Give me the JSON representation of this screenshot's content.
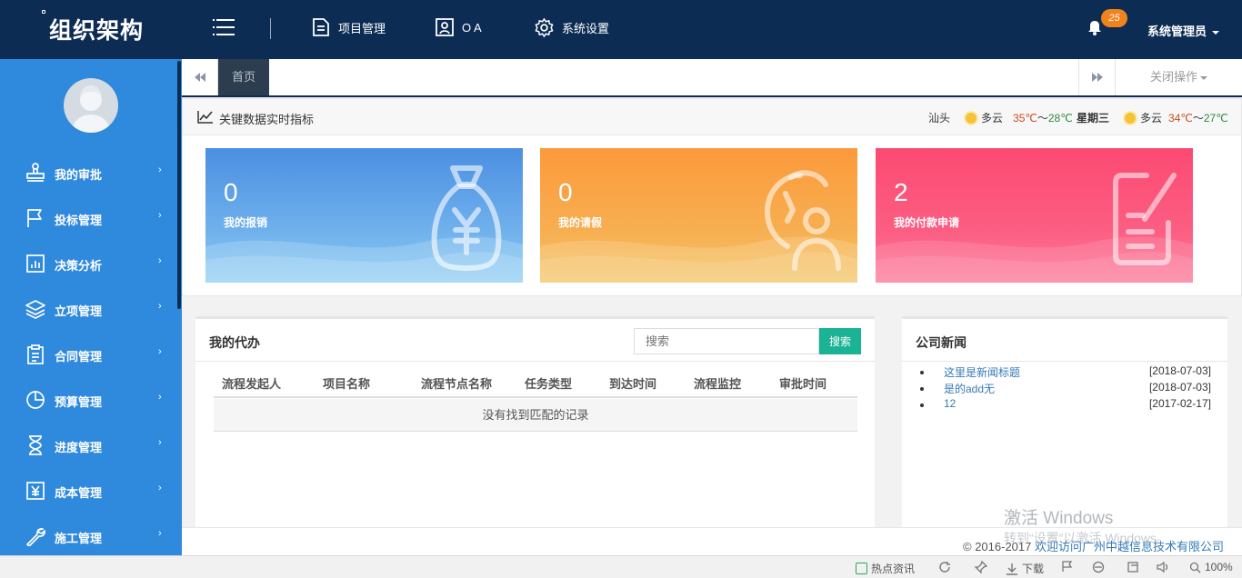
{
  "header": {
    "title": "组织架构",
    "nav": [
      {
        "label": "项目管理",
        "icon": "document-icon"
      },
      {
        "label": "O A",
        "icon": "id-card-icon"
      },
      {
        "label": "系统设置",
        "icon": "gear-icon"
      }
    ],
    "notification_count": "25",
    "user": "系统管理员"
  },
  "sidebar": {
    "items": [
      {
        "label": "我的审批",
        "icon": "stamp-icon"
      },
      {
        "label": "投标管理",
        "icon": "flag-icon"
      },
      {
        "label": "决策分析",
        "icon": "bar-chart-icon"
      },
      {
        "label": "立项管理",
        "icon": "layers-icon"
      },
      {
        "label": "合同管理",
        "icon": "clipboard-icon"
      },
      {
        "label": "预算管理",
        "icon": "pie-chart-icon"
      },
      {
        "label": "进度管理",
        "icon": "hourglass-icon"
      },
      {
        "label": "成本管理",
        "icon": "yen-icon"
      },
      {
        "label": "施工管理",
        "icon": "wrench-icon"
      }
    ],
    "arrow": "›"
  },
  "tabs": {
    "home": "首页",
    "close_ops": "关闭操作"
  },
  "kpi": {
    "title": "关键数据实时指标",
    "weather": {
      "city": "汕头",
      "today": {
        "cond": "多云",
        "high": "35℃",
        "sep": "～",
        "low": "28℃"
      },
      "weekday": "星期三",
      "tomorrow": {
        "cond": "多云",
        "high": "34℃",
        "sep": "～",
        "low": "27℃"
      }
    },
    "cards": [
      {
        "value": "0",
        "label": "我的报销",
        "color_top": "#4a8ee0",
        "color_bottom": "#7ec3ef"
      },
      {
        "value": "0",
        "label": "我的请假",
        "color_top": "#fb9a3c",
        "color_bottom": "#f5c160"
      },
      {
        "value": "2",
        "label": "我的付款申请",
        "color_top": "#fc4c74",
        "color_bottom": "#fd7a9b"
      }
    ]
  },
  "todo": {
    "title": "我的代办",
    "search_placeholder": "搜索",
    "search_button": "搜索",
    "columns": [
      "流程发起人",
      "项目名称",
      "流程节点名称",
      "任务类型",
      "到达时间",
      "流程监控",
      "审批时间"
    ],
    "empty_text": "没有找到匹配的记录"
  },
  "news": {
    "title": "公司新闻",
    "items": [
      {
        "title": "这里是新闻标题",
        "date": "[2018-07-03]"
      },
      {
        "title": "是的add无",
        "date": "[2018-07-03]"
      },
      {
        "title": "12",
        "date": "[2017-02-17]"
      }
    ]
  },
  "footer": {
    "copyright": "© 2016-2017",
    "link": "欢迎访问广州中越信息技术有限公司"
  },
  "watermark": {
    "line1": "激活 Windows",
    "line2": "转到“设置”以激活 Windows。"
  },
  "statusbar": {
    "hot_news": "热点资讯",
    "download": "下载",
    "zoom": "100%"
  }
}
